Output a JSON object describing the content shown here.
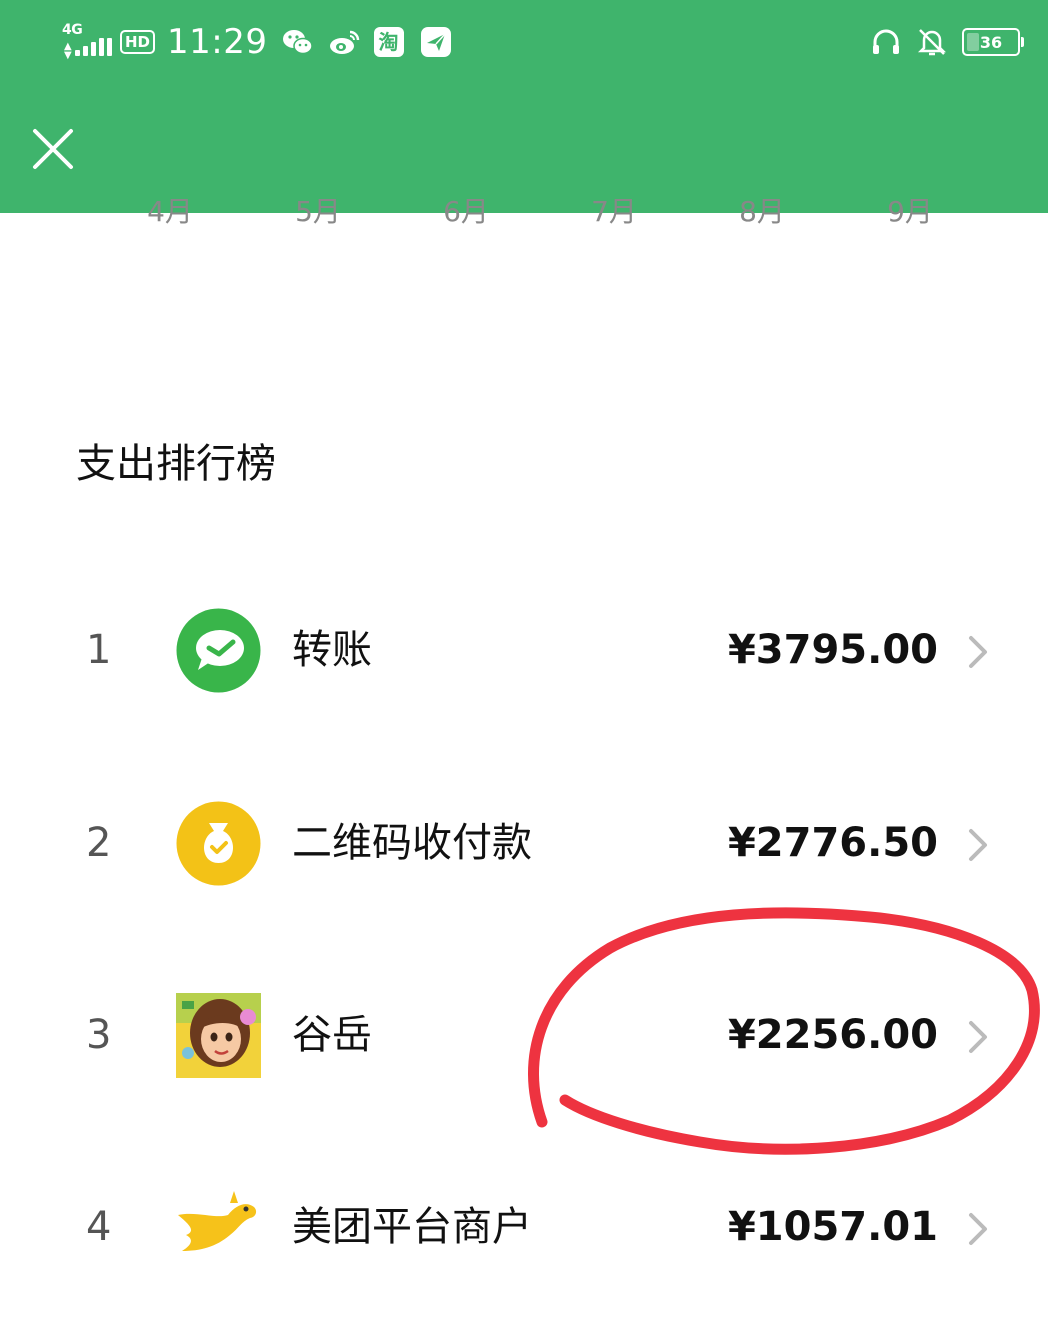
{
  "statusbar": {
    "network": "4G",
    "hd": "HD",
    "time": "11:29",
    "taobao_icon_text": "淘",
    "battery": "36",
    "icons": [
      "signal-icon",
      "wechat-icon",
      "weibo-icon",
      "taobao-icon",
      "send-icon",
      "headphones-icon",
      "mute-bell-icon",
      "battery-icon"
    ]
  },
  "header": {
    "background": "#3fb46c",
    "close_icon": "close-icon"
  },
  "months": [
    "4月",
    "5月",
    "6月",
    "7月",
    "8月",
    "9月"
  ],
  "ranking": {
    "title": "支出排行榜",
    "items": [
      {
        "rank": "1",
        "name": "转账",
        "amount": "¥3795.00",
        "icon": "wechat-transfer-icon"
      },
      {
        "rank": "2",
        "name": "二维码收付款",
        "amount": "¥2776.50",
        "icon": "qr-payment-moneybag-icon"
      },
      {
        "rank": "3",
        "name": "谷岳",
        "amount": "¥2256.00",
        "icon": "cartoon-girl-avatar"
      },
      {
        "rank": "4",
        "name": "美团平台商户",
        "amount": "¥1057.01",
        "icon": "meituan-kangaroo-icon"
      }
    ]
  },
  "annotation": {
    "type": "hand-drawn red circle around item 3 amount",
    "color": "#ee3340"
  }
}
